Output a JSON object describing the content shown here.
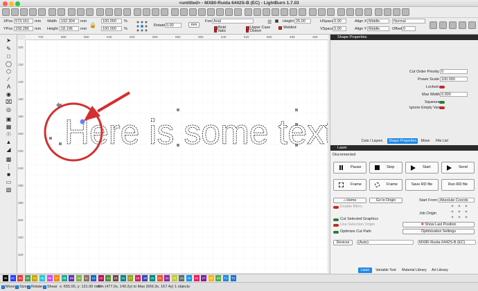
{
  "window": {
    "title": "<untitled> - MX80-Ruida 6442S-B (EC) - LightBurn 1.7.03"
  },
  "toolbar2": {
    "xpos_label": "XPos",
    "xpos_value": "573.161",
    "ypos_label": "YPos",
    "ypos_value": "158.286",
    "unit_mm": "mm",
    "width_label": "Width",
    "width_value": "192.304",
    "height_label": "Height",
    "height_value": "18.196",
    "scale_w": "100.000",
    "scale_h": "100.000",
    "percent": "%",
    "rotate_label": "Rotate",
    "rotate_value": "0.00",
    "mm_button": "mm",
    "font_label": "Font",
    "font_value": "Arial",
    "fontheight_label": "Height",
    "fontheight_value": "25.00",
    "bold_label": "Bold",
    "italic_label": "Italic",
    "upper_label": "Upper Case",
    "distort_label": "Distort",
    "welded_label": "Welded",
    "hspace_label": "HSpace",
    "hspace_value": "0.00",
    "vspace_label": "VSpace",
    "vspace_value": "0.00",
    "alignx_label": "Align X",
    "alignx_value": "Middle",
    "aligny_label": "Align Y",
    "aligny_value": "Middle",
    "mode_value": "Normal",
    "offset_label": "Offset",
    "offset_value": "0"
  },
  "ruler": {
    "x_ticks": [
      "700",
      "680",
      "660",
      "640",
      "620",
      "600",
      "580",
      "560",
      "540",
      "520",
      "500",
      "480",
      "460"
    ],
    "y_ticks": [
      "100",
      "120",
      "140",
      "160",
      "180",
      "200",
      "220",
      "240",
      "260",
      "280",
      "300",
      "320",
      "340"
    ],
    "y_ticks_right": [
      "100",
      "120",
      "140",
      "160",
      "180",
      "200",
      "220",
      "240",
      "260",
      "280",
      "300",
      "320",
      "340"
    ]
  },
  "canvas": {
    "text": "Here is some text"
  },
  "shape_properties": {
    "title": "Shape Properties",
    "cut_order_label": "Cut Order Priority",
    "cut_order_value": "0",
    "power_scale_label": "Power Scale",
    "power_scale_value": "100.000",
    "locked_label": "Locked",
    "max_width_label": "Max Width",
    "max_width_value": "0.000",
    "squeeze_label": "Squeeze",
    "ignore_label": "Ignore Empty Vars",
    "tabs": [
      "Cuts / Layers",
      "Shape Properties",
      "Move",
      "File List"
    ]
  },
  "laser": {
    "title": "Laser",
    "status": "Disconnected",
    "pause": "Pause",
    "stop": "Stop",
    "start": "Start",
    "send": "Send",
    "frame1": "Frame",
    "frame2": "Frame",
    "save_rd": "Save RD file",
    "run_rd": "Run RD file",
    "home": "Home",
    "go_origin": "Go to Origin",
    "start_from_label": "Start From:",
    "start_from_value": "Absolute Coords",
    "job_origin_label": "Job Origin",
    "enable_filters": "Enable filters",
    "cut_selected": "Cut Selected Graphics",
    "use_selection_origin": "Use Selection Origin",
    "optimize": "Optimize Cut Path",
    "show_last": "Show Last Position",
    "opt_settings": "Optimization Settings",
    "devices_button": "Devices",
    "port_value": "(Auto)",
    "device_value": "MX80-Ruida 6442S-B (EC)",
    "tabs": [
      "Laser",
      "Variable Text",
      "Material Library",
      "Art Library"
    ]
  },
  "palette": {
    "colors": [
      {
        "n": "00",
        "c": "#000000"
      },
      {
        "n": "01",
        "c": "#1e40ff"
      },
      {
        "n": "02",
        "c": "#e53935"
      },
      {
        "n": "03",
        "c": "#43a047"
      },
      {
        "n": "04",
        "c": "#c8a400"
      },
      {
        "n": "05",
        "c": "#26c6da"
      },
      {
        "n": "06",
        "c": "#e040fb"
      },
      {
        "n": "07",
        "c": "#ef8c00"
      },
      {
        "n": "08",
        "c": "#26a69a"
      },
      {
        "n": "09",
        "c": "#5e35b1"
      },
      {
        "n": "10",
        "c": "#7cb342"
      },
      {
        "n": "11",
        "c": "#8d6e63"
      },
      {
        "n": "12",
        "c": "#1565c0"
      },
      {
        "n": "13",
        "c": "#ad1457"
      },
      {
        "n": "14",
        "c": "#558b2f"
      },
      {
        "n": "15",
        "c": "#6d4c41"
      },
      {
        "n": "16",
        "c": "#00838f"
      },
      {
        "n": "17",
        "c": "#9e9d24"
      },
      {
        "n": "18",
        "c": "#d81b60"
      },
      {
        "n": "19",
        "c": "#3949ab"
      },
      {
        "n": "20",
        "c": "#00897b"
      },
      {
        "n": "21",
        "c": "#f4511e"
      },
      {
        "n": "22",
        "c": "#8e24aa"
      },
      {
        "n": "23",
        "c": "#c0ca33"
      },
      {
        "n": "24",
        "c": "#546e7a"
      },
      {
        "n": "25",
        "c": "#039be5"
      },
      {
        "n": "26",
        "c": "#e91e63"
      },
      {
        "n": "27",
        "c": "#7b1fa2"
      },
      {
        "n": "28",
        "c": "#ffb300"
      },
      {
        "n": "29",
        "c": "#4caf50"
      },
      {
        "n": "T1",
        "c": "#1e88e5"
      },
      {
        "n": "T2",
        "c": "#1976d2"
      }
    ]
  },
  "status": {
    "move": "Move",
    "size": "Size",
    "rotate": "Rotate",
    "shear": "Shear",
    "coords": "x: 655.00, y: 131.00 mm",
    "bounds": "Min (477.0x, 149.2y) to Max (669.3x, 167.4y)  1 objects"
  }
}
